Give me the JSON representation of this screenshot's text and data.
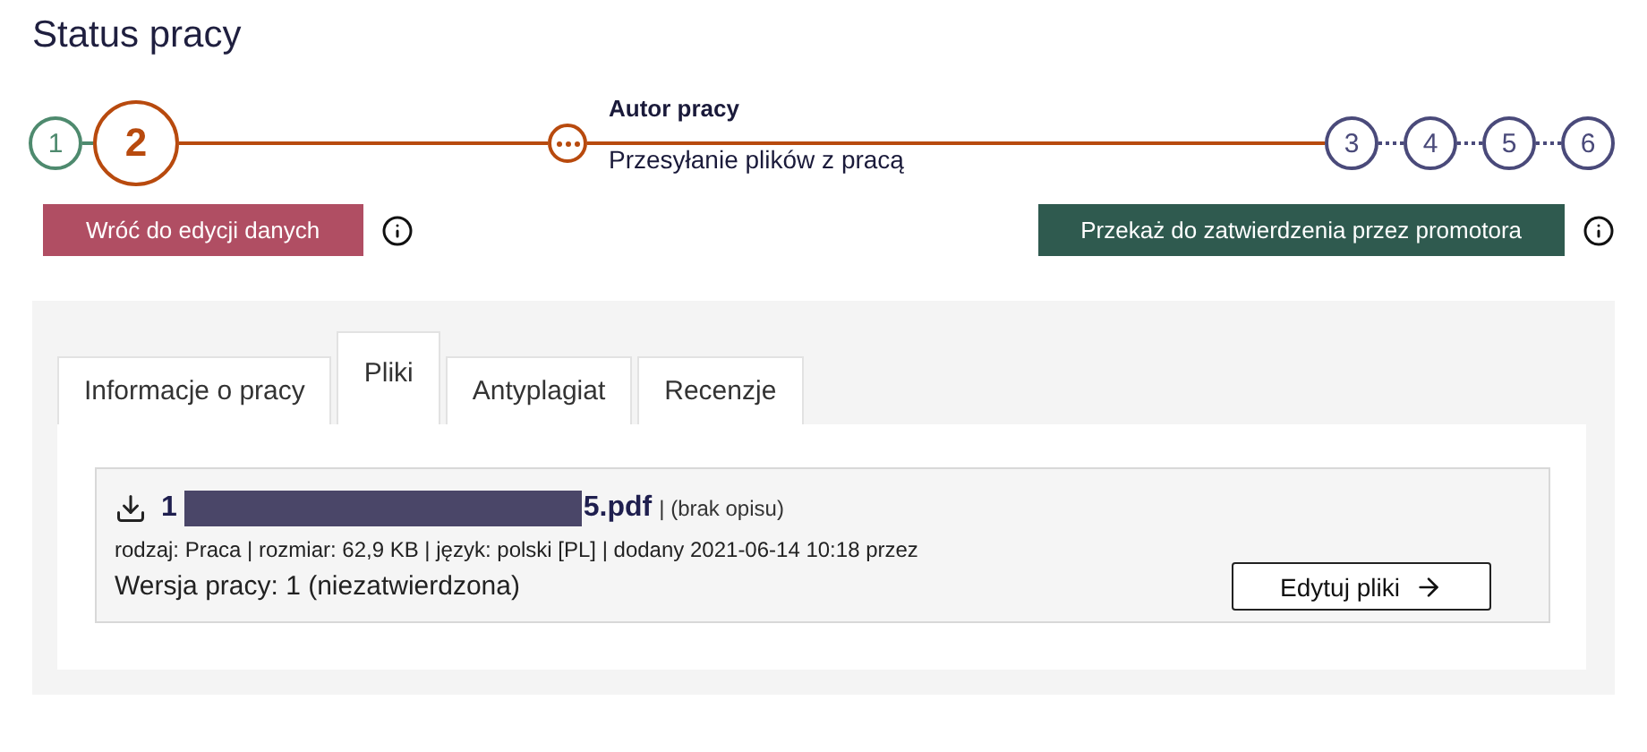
{
  "title": "Status pracy",
  "steps": [
    {
      "label": "1",
      "done": true,
      "current": false
    },
    {
      "label": "2",
      "done": false,
      "current": true
    },
    {
      "kind": "dots",
      "done": false,
      "current": true,
      "role": "Autor pracy",
      "task": "Przesyłanie plików z pracą"
    },
    {
      "label": "3",
      "done": false,
      "current": false
    },
    {
      "label": "4",
      "done": false,
      "current": false
    },
    {
      "label": "5",
      "done": false,
      "current": false
    },
    {
      "label": "6",
      "done": false,
      "current": false
    }
  ],
  "actions": [
    {
      "label": "Wróć do edycji danych",
      "kind": "back"
    },
    {
      "label": "Przekaż do zatwierdzenia przez promotora",
      "kind": "submit"
    }
  ],
  "tabs": [
    {
      "label": "Informacje o pracy",
      "selected": false
    },
    {
      "label": "Pliki",
      "selected": true
    },
    {
      "label": "Antyplagiat",
      "selected": false
    },
    {
      "label": "Recenzje",
      "selected": false
    }
  ],
  "file": {
    "name_start": "1",
    "name_end": "5.pdf",
    "description": "| (brak opisu)",
    "meta": "rodzaj: Praca | rozmiar: 62,9 KB | język: polski [PL] | dodany 2021-06-14 10:18 przez",
    "version": "Wersja pracy: 1 (niezatwierdzona)",
    "edit_button": "Edytuj pliki"
  }
}
